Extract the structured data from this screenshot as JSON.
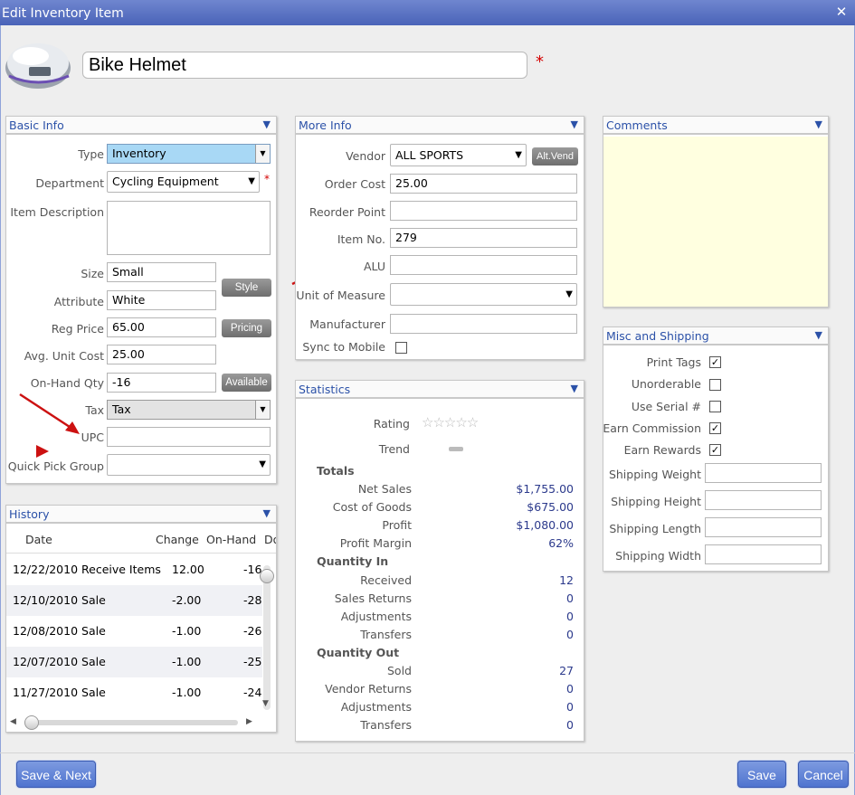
{
  "window": {
    "title": "Edit Inventory Item",
    "close_glyph": "✕"
  },
  "item": {
    "name": "Bike Helmet",
    "required_mark": "*"
  },
  "basic_info": {
    "title": "Basic Info",
    "type_label": "Type",
    "type_value": "Inventory",
    "department_label": "Department",
    "department_value": "Cycling Equipment",
    "description_label": "Item Description",
    "description_value": "",
    "size_label": "Size",
    "size_value": "Small",
    "attribute_label": "Attribute",
    "attribute_value": "White",
    "style_button": "Style",
    "reg_price_label": "Reg Price",
    "reg_price_value": "65.00",
    "pricing_button": "Pricing",
    "avg_cost_label": "Avg. Unit Cost",
    "avg_cost_value": "25.00",
    "onhand_label": "On-Hand Qty",
    "onhand_value": "-16",
    "available_button": "Available",
    "tax_label": "Tax",
    "tax_value": "Tax",
    "upc_label": "UPC",
    "upc_value": "",
    "quick_pick_label": "Quick Pick Group",
    "quick_pick_value": ""
  },
  "more_info": {
    "title": "More Info",
    "vendor_label": "Vendor",
    "vendor_value": "ALL SPORTS",
    "alt_vend_button": "Alt.Vend",
    "order_cost_label": "Order Cost",
    "order_cost_value": "25.00",
    "reorder_label": "Reorder Point",
    "reorder_value": "",
    "item_no_label": "Item No.",
    "item_no_value": "279",
    "alu_label": "ALU",
    "alu_value": "",
    "uom_label": "Unit of Measure",
    "uom_value": "",
    "manufacturer_label": "Manufacturer",
    "manufacturer_value": "",
    "sync_label": "Sync to Mobile"
  },
  "comments": {
    "title": "Comments"
  },
  "misc": {
    "title": "Misc and Shipping",
    "print_tags": "Print Tags",
    "print_tags_checked": "✓",
    "unorderable": "Unorderable",
    "use_serial": "Use Serial #",
    "earn_commission": "Earn Commission",
    "earn_commission_checked": "✓",
    "earn_rewards": "Earn Rewards",
    "earn_rewards_checked": "✓",
    "ship_weight": "Shipping Weight",
    "ship_height": "Shipping Height",
    "ship_length": "Shipping Length",
    "ship_width": "Shipping Width"
  },
  "statistics": {
    "title": "Statistics",
    "rating_label": "Rating",
    "rating_stars": "☆☆☆☆☆",
    "trend_label": "Trend",
    "totals": "Totals",
    "net_sales_label": "Net Sales",
    "net_sales": "$1,755.00",
    "cogs_label": "Cost of Goods",
    "cogs": "$675.00",
    "profit_label": "Profit",
    "profit": "$1,080.00",
    "margin_label": "Profit Margin",
    "margin": "62%",
    "qty_in": "Quantity In",
    "received_label": "Received",
    "received": "12",
    "sales_returns_label": "Sales Returns",
    "sales_returns": "0",
    "adjustments_in_label": "Adjustments",
    "adjustments_in": "0",
    "transfers_in_label": "Transfers",
    "transfers_in": "0",
    "qty_out": "Quantity Out",
    "sold_label": "Sold",
    "sold": "27",
    "vendor_returns_label": "Vendor Returns",
    "vendor_returns": "0",
    "adjustments_out_label": "Adjustments",
    "adjustments_out": "0",
    "transfers_out_label": "Transfers",
    "transfers_out": "0"
  },
  "history": {
    "title": "History",
    "col_date": "Date",
    "col_change": "Change",
    "col_onhand": "On-Hand",
    "col_doc": "Do",
    "rows": [
      {
        "date": "12/22/2010 Receive Items",
        "change": "12.00",
        "onhand": "-16"
      },
      {
        "date": "12/10/2010 Sale",
        "change": "-2.00",
        "onhand": "-28"
      },
      {
        "date": "12/08/2010 Sale",
        "change": "-1.00",
        "onhand": "-26"
      },
      {
        "date": "12/07/2010 Sale",
        "change": "-1.00",
        "onhand": "-25"
      },
      {
        "date": "11/27/2010 Sale",
        "change": "-1.00",
        "onhand": "-24"
      }
    ]
  },
  "footer": {
    "save_next": "Save & Next",
    "save": "Save",
    "cancel": "Cancel"
  },
  "colors": {
    "accent": "#4f74cf",
    "title_bar": "#5a72c2",
    "comments_bg": "#ffffe0",
    "type_combo": "#a8d8f5",
    "arrow": "#cc1111"
  },
  "icons": {
    "dropdown": "▼",
    "panel_collapse": "▼"
  }
}
